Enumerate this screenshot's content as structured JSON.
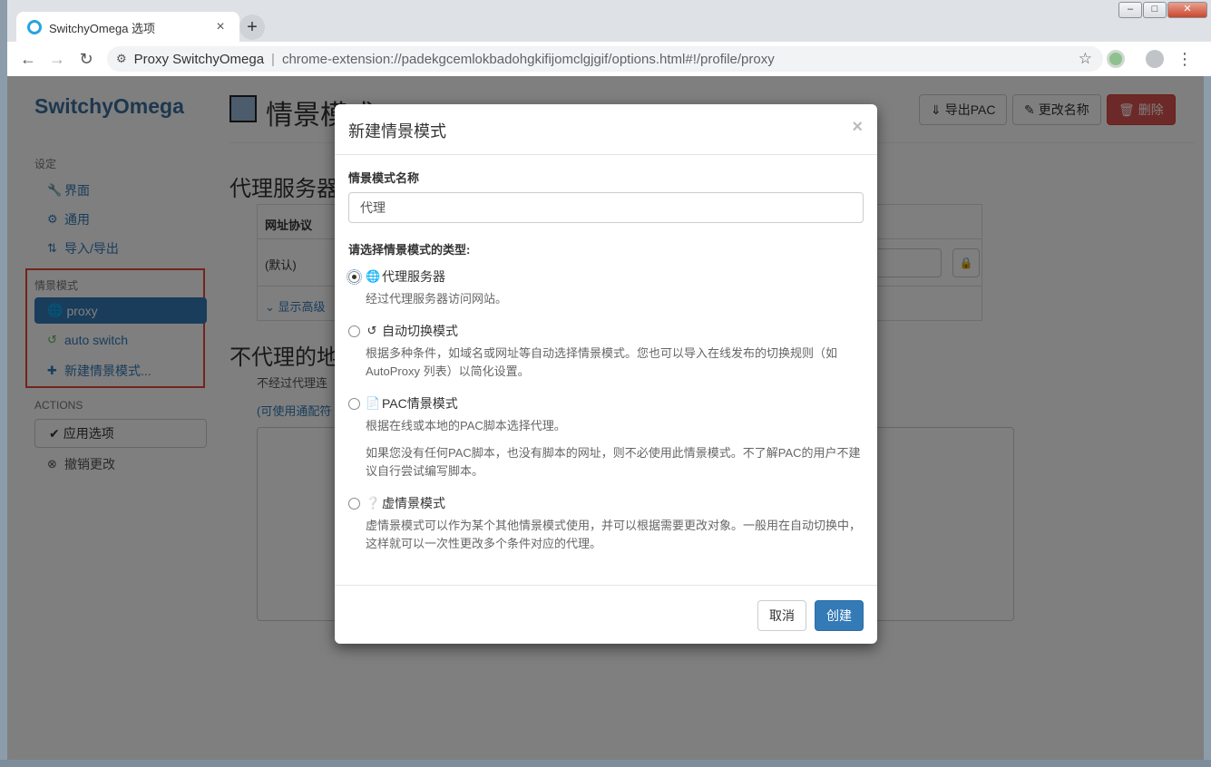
{
  "browser": {
    "tab_title": "SwitchyOmega 选项",
    "tab_close": "×",
    "new_tab": "+",
    "back": "←",
    "forward": "→",
    "reload": "↻",
    "site_name": "Proxy SwitchyOmega",
    "separator": "|",
    "url": "chrome-extension://padekgcemlokbadohgkifijomclgjgif/options.html#!/profile/proxy",
    "star": "☆",
    "menu": "⋮",
    "win_min": "–",
    "win_max": "□",
    "win_close": "✕"
  },
  "sidebar": {
    "brand": "SwitchyOmega",
    "settings_header": "设定",
    "settings_items": [
      {
        "label": "界面",
        "icon": "wrench-icon"
      },
      {
        "label": "通用",
        "icon": "gear-icon"
      },
      {
        "label": "导入/导出",
        "icon": "import-export-icon"
      }
    ],
    "profiles_header": "情景模式",
    "profiles": [
      {
        "label": "proxy",
        "icon": "globe-icon"
      },
      {
        "label": "auto switch",
        "icon": "retweet-icon"
      },
      {
        "label": "新建情景模式...",
        "icon": "plus-icon"
      }
    ],
    "actions_header": "ACTIONS",
    "apply_label": "应用选项",
    "discard_label": "撤销更改"
  },
  "main": {
    "title": "情景模式：",
    "export_pac": "导出PAC",
    "rename": "更改名称",
    "delete": "删除",
    "proxy_servers_title": "代理服务器",
    "table_header": "网址协议",
    "table_default": "(默认)",
    "show_advanced": "显示高级",
    "bypass_title": "不代理的地",
    "bypass_desc": "不经过代理连",
    "bypass_hint": "(可使用通配符"
  },
  "modal": {
    "title": "新建情景模式",
    "close": "×",
    "name_label": "情景模式名称",
    "name_value": "代理",
    "type_prompt": "请选择情景模式的类型:",
    "options": [
      {
        "label": "代理服务器",
        "icon": "globe-icon",
        "checked": true,
        "desc": [
          "经过代理服务器访问网站。"
        ]
      },
      {
        "label": "自动切换模式",
        "icon": "retweet-icon",
        "checked": false,
        "desc": [
          "根据多种条件，如域名或网址等自动选择情景模式。您也可以导入在线发布的切换规则（如 AutoProxy 列表）以简化设置。"
        ]
      },
      {
        "label": "PAC情景模式",
        "icon": "file-icon",
        "checked": false,
        "desc": [
          "根据在线或本地的PAC脚本选择代理。",
          "如果您没有任何PAC脚本，也没有脚本的网址，则不必使用此情景模式。不了解PAC的用户不建议自行尝试编写脚本。"
        ]
      },
      {
        "label": "虚情景模式",
        "icon": "question-sign-icon",
        "checked": false,
        "desc": [
          "虚情景模式可以作为某个其他情景模式使用，并可以根据需要更改对象。一般用在自动切换中，这样就可以一次性更改多个条件对应的代理。"
        ]
      }
    ],
    "cancel": "取消",
    "create": "创建"
  },
  "colors": {
    "primary": "#337ab7",
    "danger": "#d9534f",
    "highlight_box": "#e8463a"
  }
}
